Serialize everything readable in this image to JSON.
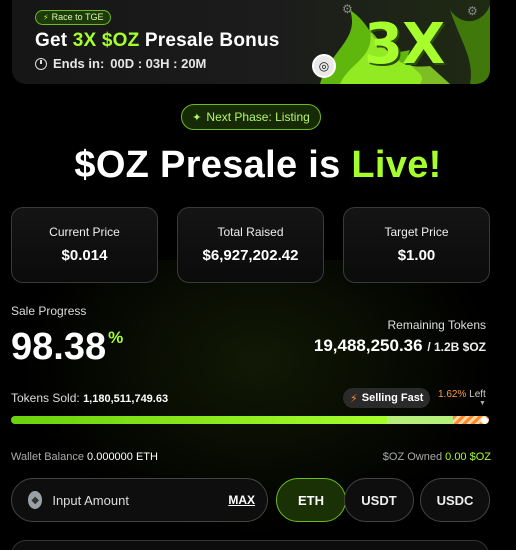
{
  "banner": {
    "pill": "Race to TGE",
    "title_prefix": "Get ",
    "title_highlight": "3X $OZ",
    "title_suffix": " Presale Bonus",
    "ends_label": "Ends in:",
    "countdown": "00D : 03H : 20M",
    "big_text": "3X"
  },
  "phase_pill": "Next Phase: Listing",
  "hero": {
    "title_main": "$OZ Presale is ",
    "title_live": "Live!"
  },
  "stats": [
    {
      "label": "Current Price",
      "value": "$0.014"
    },
    {
      "label": "Total Raised",
      "value": "$6,927,202.42"
    },
    {
      "label": "Target Price",
      "value": "$1.00"
    }
  ],
  "sale_progress": {
    "label": "Sale Progress",
    "percent": "98.38",
    "percent_symbol": "%"
  },
  "remaining": {
    "label": "Remaining Tokens",
    "value": "19,488,250.36",
    "of": "/ 1.2B $OZ"
  },
  "tokens_sold": {
    "label": "Tokens Sold:",
    "value": "1,180,511,749.63"
  },
  "selling_badge": "Selling Fast",
  "left": {
    "pct": "1.62%",
    "word": "Left"
  },
  "progress": {
    "filled": 0.9838,
    "stripe_fraction": 0.0162,
    "colors": {
      "fill": "#a6ff2c",
      "stripes": "#ff8a2a"
    }
  },
  "wallet": {
    "label": "Wallet Balance",
    "value": "0.000000 ETH"
  },
  "owned": {
    "label": "$OZ Owned",
    "value": "0.00 $OZ"
  },
  "input": {
    "placeholder": "Input Amount",
    "max_label": "MAX"
  },
  "currencies": [
    "ETH",
    "USDT",
    "USDC"
  ],
  "active_currency": "ETH",
  "accent": "#a6ff2c"
}
